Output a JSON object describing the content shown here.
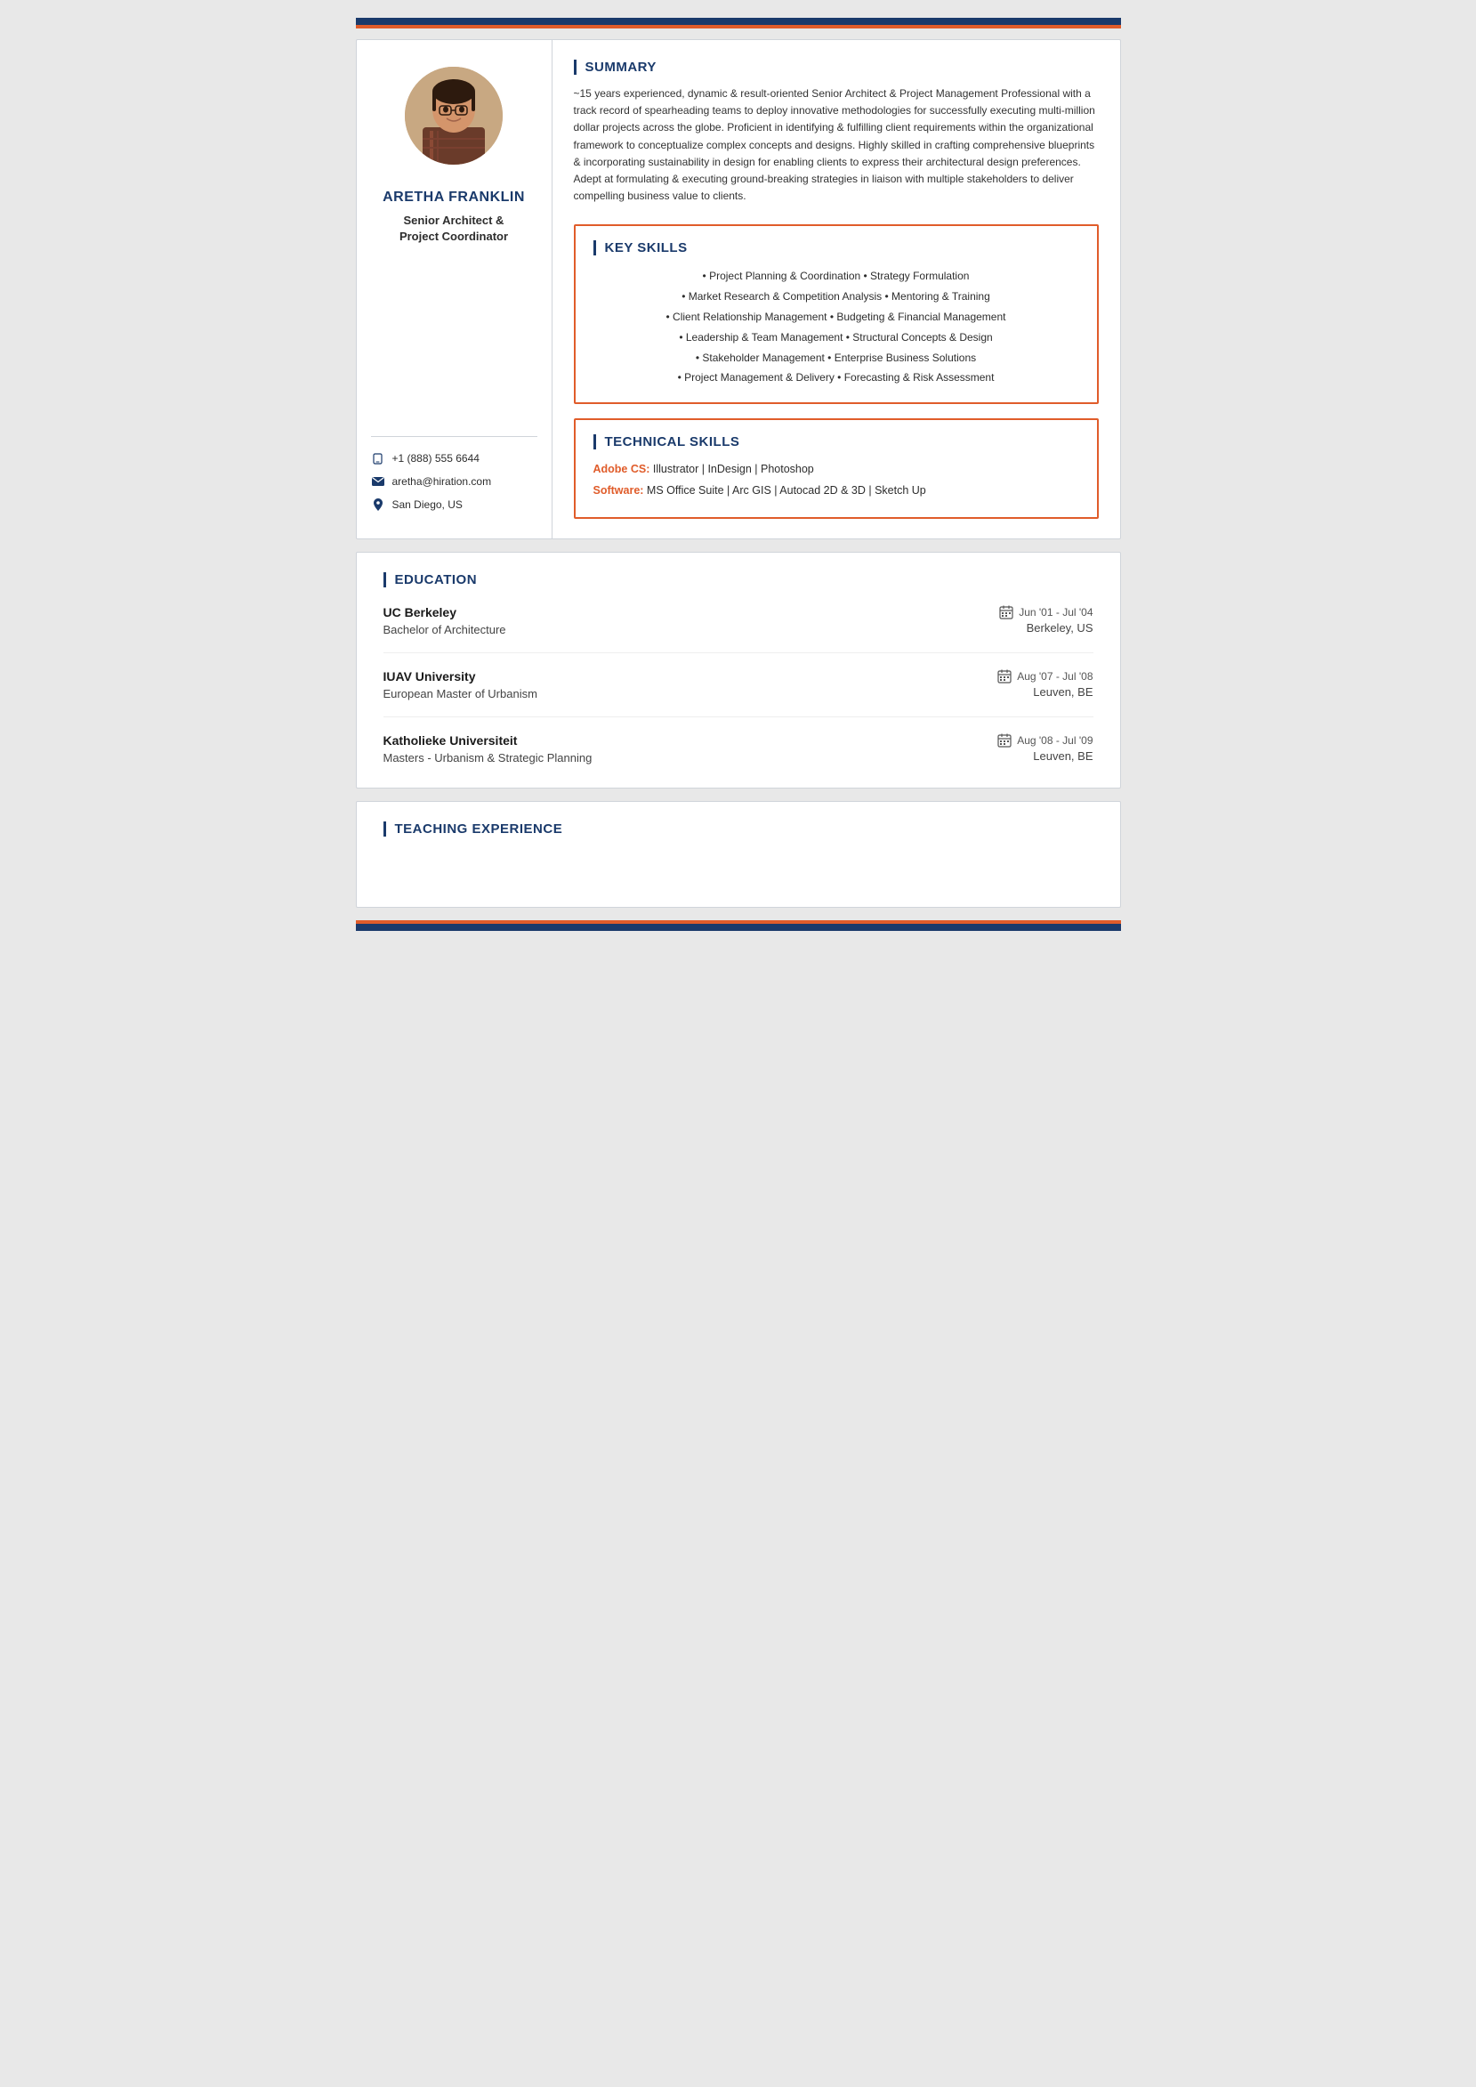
{
  "topBar": true,
  "person": {
    "name": "ARETHA FRANKLiN",
    "title_line1": "Senior Architect &",
    "title_line2": "Project Coordinator"
  },
  "contact": {
    "phone": "+1 (888) 555 6644",
    "email": "aretha@hiration.com",
    "location": "San Diego, US"
  },
  "summary": {
    "heading": "SUMMARY",
    "text": "~15 years experienced, dynamic & result-oriented Senior Architect & Project Management Professional with a track record of spearheading teams to deploy innovative methodologies for successfully executing multi-million dollar projects across the globe. Proficient in identifying & fulfilling client requirements within the organizational framework to conceptualize complex concepts and designs. Highly skilled in crafting comprehensive blueprints & incorporating sustainability in design for enabling clients to express their architectural design preferences. Adept at formulating & executing ground-breaking strategies in liaison with multiple stakeholders to deliver compelling business value to clients."
  },
  "keySkills": {
    "heading": "KEY SKILLS",
    "skills": [
      "• Project Planning & Coordination • Strategy Formulation",
      "• Market Research & Competition Analysis • Mentoring & Training",
      "• Client Relationship Management • Budgeting & Financial Management",
      "• Leadership & Team Management • Structural Concepts & Design",
      "• Stakeholder Management • Enterprise Business Solutions",
      "• Project Management & Delivery • Forecasting & Risk Assessment"
    ]
  },
  "technicalSkills": {
    "heading": "TECHNICAL SKILLS",
    "lines": [
      {
        "label": "Adobe CS:",
        "text": " Illustrator | InDesign | Photoshop"
      },
      {
        "label": "Software:",
        "text": " MS Office Suite | Arc GIS | Autocad 2D & 3D | Sketch Up"
      }
    ]
  },
  "education": {
    "heading": "EDUCATION",
    "entries": [
      {
        "school": "UC Berkeley",
        "date": "Jun '01 -  Jul '04",
        "degree": "Bachelor of Architecture",
        "location": "Berkeley, US"
      },
      {
        "school": "IUAV University",
        "date": "Aug '07 -  Jul '08",
        "degree": "European Master of Urbanism",
        "location": "Leuven, BE"
      },
      {
        "school": "Katholieke Universiteit",
        "date": "Aug '08 -  Jul '09",
        "degree": "Masters - Urbanism & Strategic Planning",
        "location": "Leuven, BE"
      }
    ]
  },
  "teaching": {
    "heading": "TEACHING EXPERIENCE"
  }
}
